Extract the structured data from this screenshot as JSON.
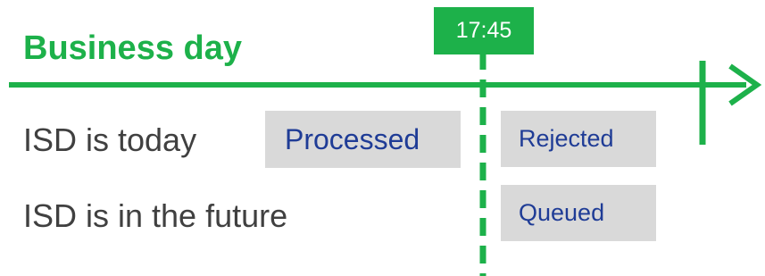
{
  "title": "Business day",
  "cutoff_time": "17:45",
  "rows": [
    {
      "label": "ISD is today"
    },
    {
      "label": "ISD is in the future"
    }
  ],
  "statuses": {
    "before_cutoff_today": "Processed",
    "after_cutoff_today": "Rejected",
    "after_cutoff_future": "Queued"
  },
  "colors": {
    "green": "#1db14a",
    "box_fill": "#d9d9d9",
    "status_text": "#1f3c96",
    "label_text": "#404040"
  }
}
